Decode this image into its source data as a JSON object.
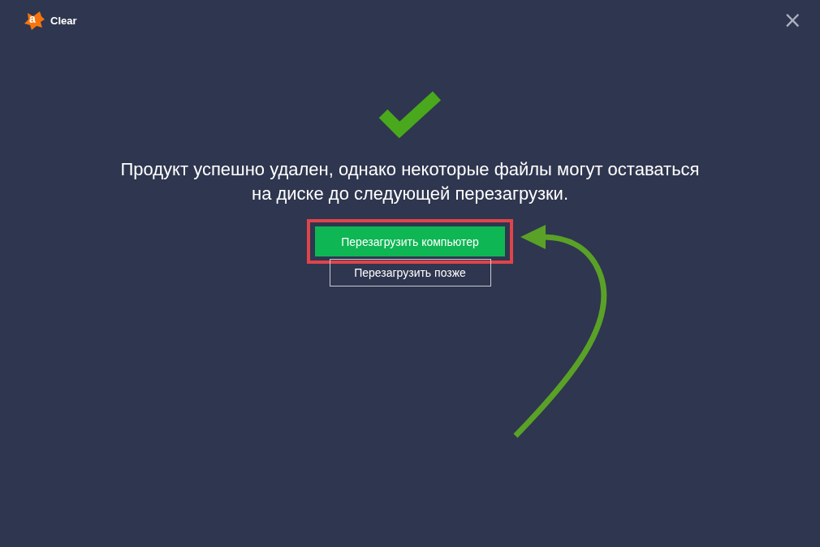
{
  "app": {
    "logo_letter": "a",
    "title": "Clear",
    "close": "×"
  },
  "message": "Продукт успешно удален, однако некоторые файлы могут оставаться на диске до следующей перезагрузки.",
  "buttons": [
    {
      "label": "Перезагрузить компьютер",
      "kind": "primary",
      "highlighted": true
    },
    {
      "label": "Перезагрузить позже",
      "kind": "outline",
      "highlighted": false
    }
  ]
}
